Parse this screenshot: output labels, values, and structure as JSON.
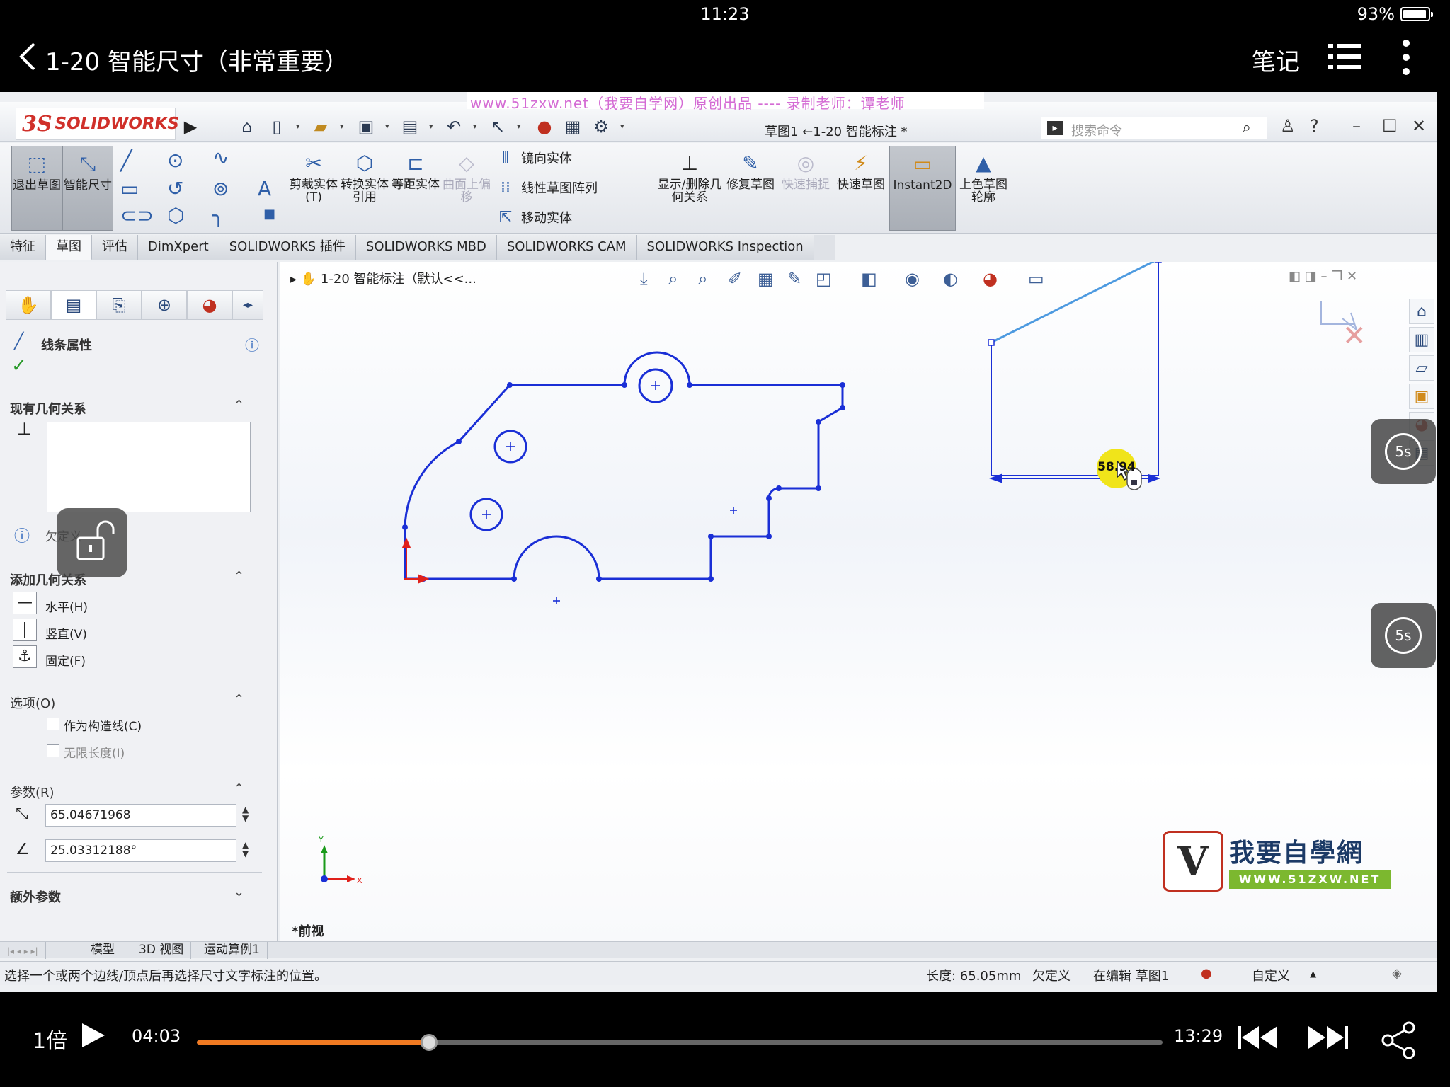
{
  "status_bar": {
    "time": "11:23",
    "battery": "93%",
    "battery_level": 0.93
  },
  "video_header": {
    "back_icon": "back-chevron-icon",
    "title": "1-20 智能尺寸（非常重要）",
    "notes": "笔记",
    "list_icon": "list-icon",
    "more_icon": "more-icon"
  },
  "watermark_banner": "www.51zxw.net（我要自学网）原创出品 ---- 录制老师：谭老师",
  "solidworks": {
    "logo": {
      "ds": "3S",
      "name": "SOLIDWORKS"
    },
    "document_title": "草图1 ←1-20 智能标注 *",
    "search_placeholder": "搜索命令",
    "command_manager": {
      "exit_sketch": "退出草图",
      "smart_dimension": "智能尺寸",
      "trim": "剪裁实体(T)",
      "convert": "转换实体引用",
      "offset": "等距实体",
      "surface_offset": "曲面上偏移",
      "mirror": "镜向实体",
      "linear_pattern": "线性草图阵列",
      "move": "移动实体",
      "display_relations": "显示/删除几何关系",
      "repair": "修复草图",
      "quick_snaps": "快速捕捉",
      "rapid_sketch": "快速草图",
      "instant2d": "Instant2D",
      "shaded_contours": "上色草图轮廓"
    },
    "tabs": [
      "特征",
      "草图",
      "评估",
      "DimXpert",
      "SOLIDWORKS 插件",
      "SOLIDWORKS MBD",
      "SOLIDWORKS CAM",
      "SOLIDWORKS Inspection"
    ],
    "active_tab": "草图",
    "property_manager": {
      "title": "线条属性",
      "existing_relations": "现有几何关系",
      "info_text": "欠定义",
      "add_relations": "添加几何关系",
      "relations": [
        "水平(H)",
        "竖直(V)",
        "固定(F)"
      ],
      "options": "选项(O)",
      "option_items": [
        "作为构造线(C)",
        "无限长度(I)"
      ],
      "parameters": "参数(R)",
      "length": "65.04671968",
      "angle": "25.03312188°",
      "extra_params": "额外参数"
    },
    "graphics": {
      "tree_item": "1-20 智能标注（默认<<...",
      "view_label": "*前视",
      "dimension_value": "58.94",
      "axis_y": "Y",
      "axis_x": "X",
      "logo_text": "我要自學網",
      "logo_url": "WWW.51ZXW.NET"
    },
    "bottom_tabs": [
      "模型",
      "3D 视图",
      "运动算例1"
    ],
    "status_line": {
      "hint": "选择一个或两个边线/顶点后再选择尺寸文字标注的位置。",
      "length": "长度: 65.05mm",
      "state": "欠定义",
      "editing": "在编辑 草图1",
      "units": "自定义"
    }
  },
  "overlay": {
    "skip_forward": "5s",
    "skip_back": "5s"
  },
  "player": {
    "speed": "1倍",
    "current_time": "04:03",
    "total_time": "13:29",
    "progress": 0.2405,
    "accent": "#f07a22"
  }
}
